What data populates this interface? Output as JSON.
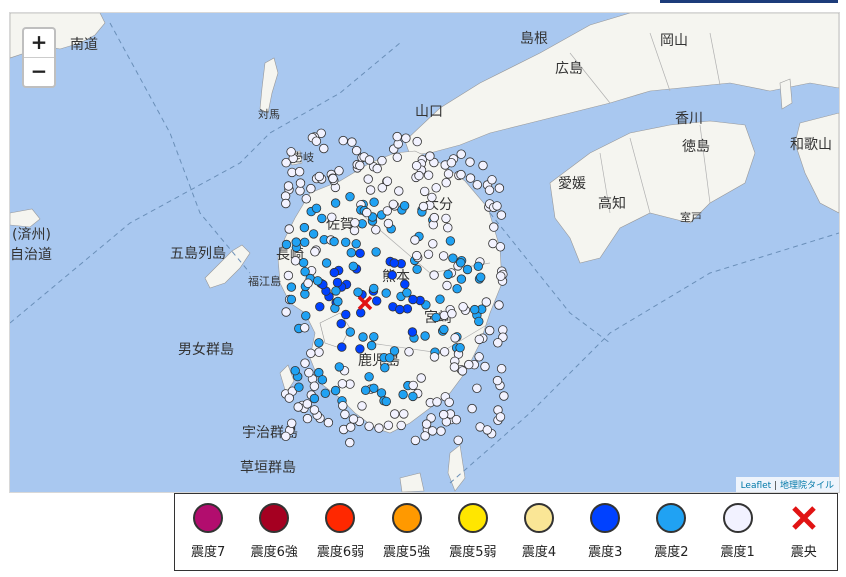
{
  "zoom": {
    "in_label": "+",
    "out_label": "−"
  },
  "attribution": {
    "leaflet": "Leaflet",
    "sep": " | ",
    "tiles": "地理院タイル"
  },
  "place_labels": {
    "shimane": "島根",
    "okayama": "岡山",
    "hiroshima": "広島",
    "yamaguchi": "山口",
    "kagawa": "香川",
    "tokushima": "徳島",
    "wakayama": "和歌山",
    "ehime": "愛媛",
    "kochi": "高知",
    "oita": "大分",
    "miyazaki": "宮崎",
    "kumamoto": "熊本",
    "kagoshima": "鹿児島",
    "nagasaki": "長崎",
    "saga": "佐賀",
    "goto": "五島列島",
    "danjo": "男女群島",
    "uji": "宇治群島",
    "kusagaki": "草垣群島",
    "tsushima": "対馬",
    "jeju": "(済州)",
    "jeju_admin": "自治道",
    "iki": "壱岐",
    "korea_tr": "南道",
    "fukue": "福江島",
    "muroto": "室戸"
  },
  "legend": [
    {
      "label": "震度7",
      "color": "#b20d6e"
    },
    {
      "label": "震度6強",
      "color": "#a50021"
    },
    {
      "label": "震度6弱",
      "color": "#ff2800"
    },
    {
      "label": "震度5強",
      "color": "#ff9900"
    },
    {
      "label": "震度5弱",
      "color": "#ffe600"
    },
    {
      "label": "震度4",
      "color": "#fae696"
    },
    {
      "label": "震度3",
      "color": "#0041ff"
    },
    {
      "label": "震度2",
      "color": "#20a2f3"
    },
    {
      "label": "震度1",
      "color": "#f2f2ff"
    },
    {
      "label": "震央",
      "color": "#e11313"
    }
  ]
}
